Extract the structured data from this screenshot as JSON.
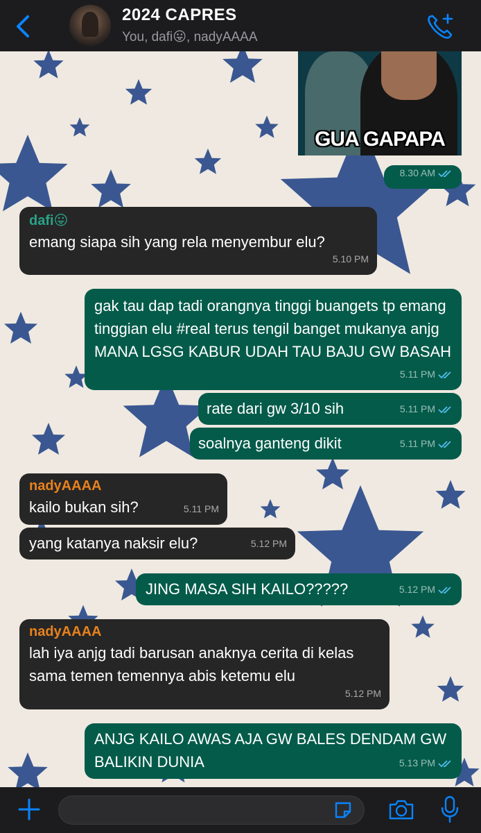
{
  "header": {
    "title": "2024 CAPRES",
    "subtitle": "You, dafi😛, nadyAAAA",
    "back_icon": "chevron-left-icon",
    "call_icon": "add-call-icon",
    "accent_color": "#0a84ff"
  },
  "messages": [
    {
      "type": "sticker",
      "caption": "GUA GAPAPA",
      "time": "8.30 AM",
      "direction": "out"
    },
    {
      "direction": "in",
      "sender": "dafi😛",
      "sender_color": "#2aa388",
      "text": "emang siapa sih yang rela menyembur elu?",
      "time": "5.10 PM"
    },
    {
      "direction": "out",
      "text": "gak tau dap tadi orangnya tinggi buangets tp emang tinggian elu #real terus tengil banget mukanya anjg MANA LGSG KABUR UDAH TAU BAJU GW BASAH",
      "time": "5.11 PM"
    },
    {
      "direction": "out",
      "text": "rate dari gw 3/10 sih",
      "time": "5.11 PM"
    },
    {
      "direction": "out",
      "text": "soalnya ganteng dikit",
      "time": "5.11 PM"
    },
    {
      "direction": "in",
      "sender": "nadyAAAA",
      "sender_color": "#e8821e",
      "text": "kailo bukan sih?",
      "time": "5.11 PM"
    },
    {
      "direction": "in",
      "text": "yang katanya naksir elu?",
      "time": "5.12 PM"
    },
    {
      "direction": "out",
      "text": "JING MASA SIH KAILO?????",
      "time": "5.12 PM"
    },
    {
      "direction": "in",
      "sender": "nadyAAAA",
      "sender_color": "#e8821e",
      "text": "lah iya anjg tadi barusan anaknya cerita di kelas sama temen temennya abis ketemu elu",
      "time": "5.12 PM"
    },
    {
      "direction": "out",
      "text": "ANJG KAILO AWAS AJA GW BALES DENDAM GW BALIKIN DUNIA",
      "time": "5.13 PM"
    }
  ],
  "input": {
    "placeholder": "",
    "plus_icon": "plus-icon",
    "sticker_icon": "sticker-icon",
    "camera_icon": "camera-icon",
    "mic_icon": "microphone-icon"
  },
  "colors": {
    "incoming_bubble": "#262626",
    "outgoing_bubble": "#045b4a",
    "read_ticks": "#53bdeb",
    "wallpaper_star": "#2a4a8a"
  }
}
